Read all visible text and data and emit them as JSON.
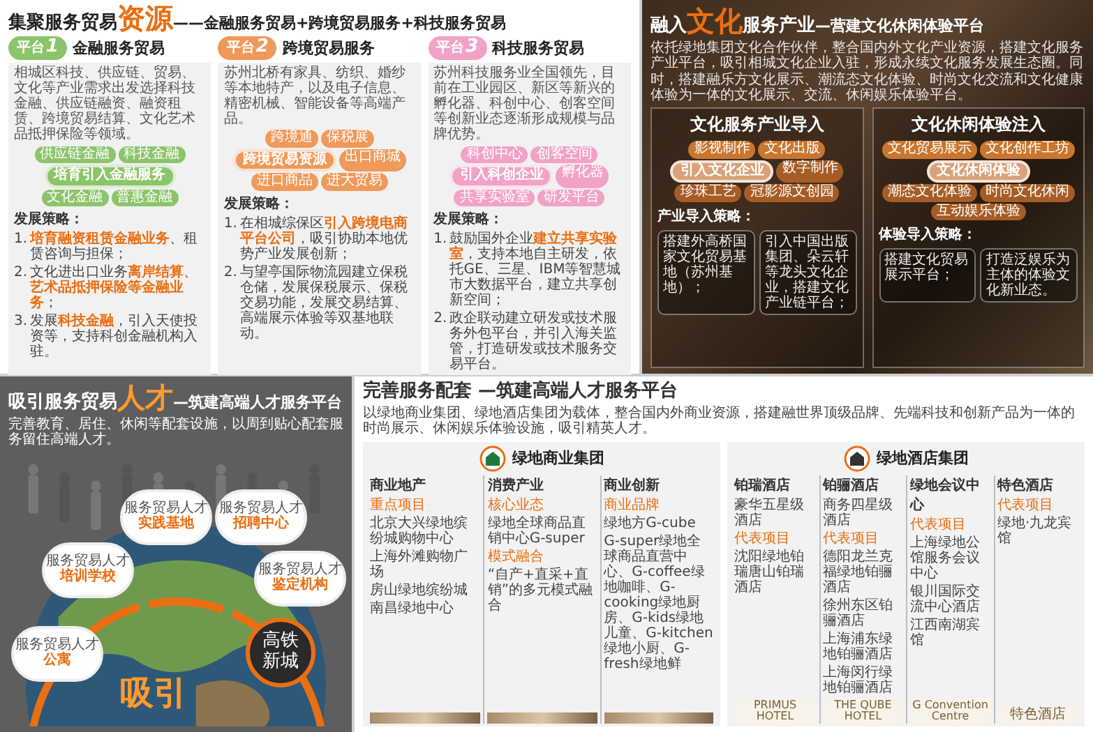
{
  "finance_slide": {
    "title": {
      "lead": "集聚服务贸易",
      "highlight": "资源",
      "tail": "——金融服务贸易+跨境贸易服务+科技服务贸易"
    },
    "platforms": [
      {
        "badge": "平台",
        "number": "1",
        "name": "金融服务贸易",
        "color": "#8cc46a",
        "description": "相城区科技、供应链、贸易、文化等产业需求出发选择科技金融、供应链融资、融资租赁、跨境贸易结算、文化艺术品抵押保险等领域。",
        "diagram": {
          "center": "培育引入金融服务",
          "nodes": [
            "供应链金融",
            "科技金融",
            "文化金融",
            "普惠金融"
          ]
        },
        "strategy_heading": "发展策略：",
        "strategies": [
          {
            "number": "1.",
            "text": "**培育融资租赁金融业务**、租赁咨询与担保；"
          },
          {
            "number": "2.",
            "text": "文化进出口业务**离岸结算**、**艺术品抵押保险等金融业务**；"
          },
          {
            "number": "3.",
            "text": "发展**科技金融**，引入天使投资等，支持科创金融机构入驻。"
          }
        ]
      },
      {
        "badge": "平台",
        "number": "2",
        "name": "跨境贸易服务",
        "color": "#ef9a5a",
        "description": "苏州北桥有家具、纺织、婚纱等本地特产，以及电子信息、精密机械、智能设备等高端产品。",
        "diagram": {
          "center": "跨境贸易资源",
          "nodes": [
            "跨境通",
            "保税展",
            "出口商城",
            "进口商品",
            "进大贸易"
          ]
        },
        "strategy_heading": "发展策略：",
        "strategies": [
          {
            "number": "1.",
            "text": "在相城综保区**引入跨境电商平台公司**，吸引协助本地优势产业发展创新；"
          },
          {
            "number": "2.",
            "text": "与望亭国际物流园建立保税仓储，发展保税展示、保税交易功能，发展交易结算、高端展示体验等双基地联动。"
          }
        ]
      },
      {
        "badge": "平台",
        "number": "3",
        "name": "科技服务贸易",
        "color": "#f2a2c6",
        "description": "苏州科技服务业全国领先，目前在工业园区、新区等新兴的孵化器、科创中心、创客空间等创新业态逐渐形成规模与品牌优势。",
        "diagram": {
          "center": "引入科创企业",
          "nodes": [
            "科创中心",
            "创客空间",
            "孵化器",
            "共享实验室",
            "研发平台"
          ]
        },
        "strategy_heading": "发展策略：",
        "strategies": [
          {
            "number": "1.",
            "text": "鼓励国外企业**建立共享实验室**，支持本地自主研发，依托GE、三星、IBM等智慧城市大数据平台，建立共享创新空间；"
          },
          {
            "number": "2.",
            "text": "政企联动建立研发或技术服务外包平台，并引入海关监管，打造研发或技术服务交易平台。"
          }
        ]
      }
    ]
  },
  "culture_slide": {
    "title": {
      "lead": "融入",
      "highlight": "文化",
      "middle": "服务产业",
      "tail": "—营建文化休闲体验平台"
    },
    "intro": "依托绿地集团文化合作伙伴，整合国内外文化产业资源，搭建文化服务产业平台，吸引相城文化企业入驻，形成永续文化服务发展生态圈。同时，搭建融乐方文化展示、潮流态文化体验、时尚文化交流和文化健康体验为一体的文化展示、交流、休闲娱乐体验平台。",
    "panels": [
      {
        "heading": "文化服务产业导入",
        "diagram": {
          "center": "引入文化企业",
          "nodes": [
            "影视制作",
            "文化出版",
            "数字制作",
            "珍珠工艺",
            "冠影源文创园"
          ]
        },
        "strategy_heading": "产业导入策略：",
        "strategies": [
          "搭建外高桥国家文化贸易基地（苏州基地）；",
          "引入中国出版集团、朵云轩等龙头文化企业，搭建文化产业链平台；"
        ]
      },
      {
        "heading": "文化休闲体验注入",
        "diagram": {
          "center": "文化休闲体验",
          "nodes": [
            "文化贸易展示",
            "文化创作工坊",
            "潮态文化体验",
            "时尚文化休闲",
            "互动娱乐体验"
          ]
        },
        "strategy_heading": "体验导入策略：",
        "strategies": [
          "搭建文化贸易展示平台；",
          "打造泛娱乐为主体的体验文化新业态。"
        ]
      }
    ]
  },
  "talent_slide": {
    "title": {
      "lead": "吸引服务贸易",
      "highlight": "人才",
      "tail": "—筑建高端人才服务平台"
    },
    "subtitle": "完善教育、居住、休闲等配套设施，以周到贴心配套服务留住高端人才。",
    "facilities": [
      {
        "caption": "服务贸易人才",
        "name": "实践基地"
      },
      {
        "caption": "服务贸易人才",
        "name": "招聘中心"
      },
      {
        "caption": "服务贸易人才",
        "name": "培训学校"
      },
      {
        "caption": "服务贸易人才",
        "name": "鉴定机构"
      },
      {
        "caption": "服务贸易人才",
        "name": "公寓"
      }
    ],
    "hub": "高铁新城",
    "banner": "吸引"
  },
  "services_slide": {
    "title": "完善服务配套 —筑建高端人才服务平台",
    "intro": "以绿地商业集团、绿地酒店集团为载体，整合国内外商业资源，搭建融世界顶级品牌、先端科技和创新产品为一体的时尚展示、休闲娱乐体验设施，吸引精英人才。",
    "groups": [
      {
        "name": "绿地商业集团",
        "kind": "commerce",
        "color": "#1e7a3c",
        "columns": [
          {
            "title": "商业地产",
            "sections": [
              {
                "label": "重点项目",
                "items": [
                  "北京大兴绿地缤纷城购物中心",
                  "上海外滩购物广场",
                  "房山绿地缤纷城",
                  "南昌绿地中心"
                ]
              }
            ]
          },
          {
            "title": "消费产业",
            "sections": [
              {
                "label": "核心业态",
                "items": [
                  "绿地全球商品直销中心G-super"
                ]
              },
              {
                "label": "模式融合",
                "items": [
                  "“自产+直采+直销”的多元模式融合"
                ]
              }
            ]
          },
          {
            "title": "商业创新",
            "sections": [
              {
                "label": "商业品牌",
                "items": [
                  "绿地方G-cube",
                  "G-super绿地全球商品直营中心、G-coffee绿地咖啡、G-cooking绿地厨房、G-kids绿地儿童、G-kitchen绿地小厨、G-fresh绿地鲜"
                ]
              }
            ]
          }
        ]
      },
      {
        "name": "绿地酒店集团",
        "kind": "hotel",
        "color": "#333333",
        "columns": [
          {
            "title": "铂瑞酒店",
            "sections": [
              {
                "items": [
                  "豪华五星级酒店"
                ]
              },
              {
                "label": "代表项目",
                "items": [
                  "沈阳绿地铂瑞唐山铂瑞酒店"
                ]
              }
            ],
            "logo": "PRIMUS HOTEL"
          },
          {
            "title": "铂骊酒店",
            "sections": [
              {
                "items": [
                  "商务四星级酒店"
                ]
              },
              {
                "label": "代表项目",
                "items": [
                  "德阳龙兰克福绿地铂骊酒店",
                  "徐州东区铂骊酒店",
                  "上海浦东绿地铂骊酒店",
                  "上海闵行绿地铂骊酒店"
                ]
              }
            ],
            "logo": "THE QUBE HOTEL"
          },
          {
            "title": "绿地会议中心",
            "sections": [
              {
                "label": "代表项目",
                "items": [
                  "上海绿地公馆服务会议中心",
                  "银川国际交流中心酒店",
                  "江西南湖宾馆"
                ]
              }
            ],
            "logo": "G Convention Centre"
          },
          {
            "title": "特色酒店",
            "sections": [
              {
                "label": "代表项目",
                "items": [
                  "绿地·九龙宾馆"
                ]
              }
            ],
            "logo": "特色酒店"
          }
        ]
      }
    ]
  }
}
